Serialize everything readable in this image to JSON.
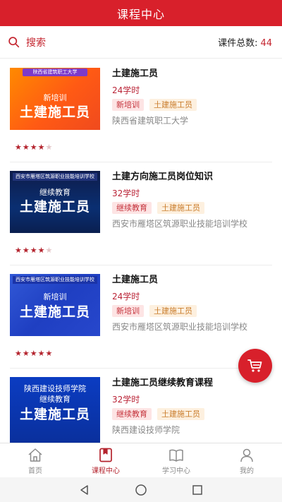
{
  "header": {
    "title": "课程中心"
  },
  "search": {
    "label": "搜索",
    "total_label": "课件总数:",
    "total_count": "44"
  },
  "courses": [
    {
      "title": "土建施工员",
      "hours": "24学时",
      "tags": [
        "新培训",
        "土建施工员"
      ],
      "school": "陕西省建筑职工大学",
      "rating": 4,
      "thumb": {
        "banner": "陕西省建筑职工大学",
        "sub": "新培训",
        "big": "土建施工员"
      }
    },
    {
      "title": "土建方向施工员岗位知识",
      "hours": "32学时",
      "tags": [
        "继续教育",
        "土建施工员"
      ],
      "school": "西安市雁塔区筑源职业技能培训学校",
      "rating": 4,
      "thumb": {
        "banner": "西安市雁塔区筑源职业技能培训学校",
        "sub": "继续教育",
        "big": "土建施工员"
      }
    },
    {
      "title": "土建施工员",
      "hours": "24学时",
      "tags": [
        "新培训",
        "土建施工员"
      ],
      "school": "西安市雁塔区筑源职业技能培训学校",
      "rating": 5,
      "thumb": {
        "banner": "西安市雁塔区筑源职业技能培训学校",
        "sub": "新培训",
        "big": "土建施工员"
      }
    },
    {
      "title": "土建施工员继续教育课程",
      "hours": "32学时",
      "tags": [
        "继续教育",
        "土建施工员"
      ],
      "school": "陕西建设技师学院",
      "rating": 0,
      "thumb": {
        "sub1": "陕西建设技师学院",
        "sub": "继续教育",
        "big": "土建施工员"
      }
    }
  ],
  "tabbar": {
    "items": [
      {
        "label": "首页",
        "icon": "home-icon"
      },
      {
        "label": "课程中心",
        "icon": "course-center-icon",
        "active": true
      },
      {
        "label": "学习中心",
        "icon": "book-icon"
      },
      {
        "label": "我的",
        "icon": "user-icon"
      }
    ]
  },
  "colors": {
    "brand_red": "#d8202b",
    "star_on": "#b4242e",
    "hours_color": "#ba2336"
  }
}
